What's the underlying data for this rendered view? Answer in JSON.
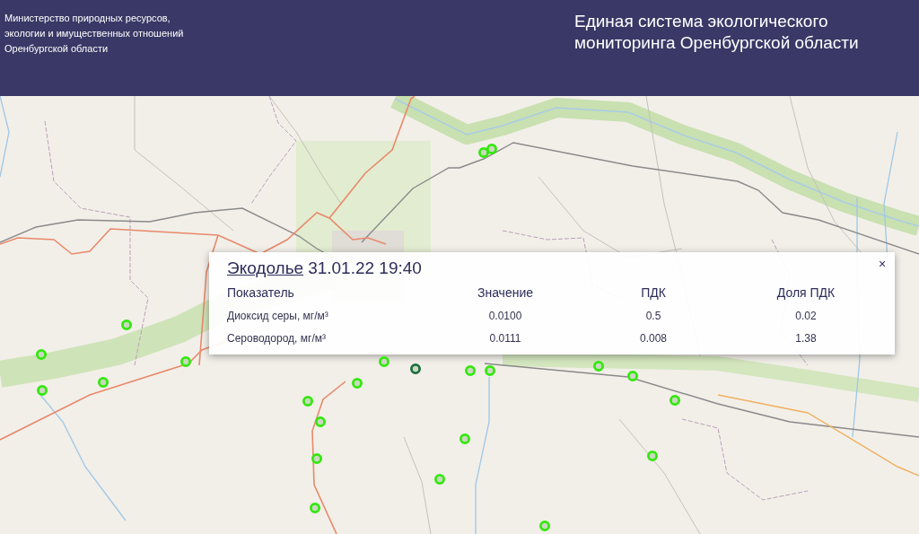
{
  "header": {
    "ministry": "Министерство природных ресурсов,\nэкологии и имущественных отношений\nОренбургской области",
    "title": "Единая система экологического\nмониторинга Оренбургской области"
  },
  "map": {
    "markers": [
      {
        "color": "#33e80c"
      },
      {
        "color": "#33e80c"
      },
      {
        "color": "#33e80c"
      },
      {
        "color": "#33e80c"
      },
      {
        "color": "#33e80c"
      },
      {
        "color": "#33e80c"
      },
      {
        "color": "#33e80c"
      },
      {
        "color": "#1f6e3f"
      },
      {
        "color": "#33e80c"
      },
      {
        "color": "#33e80c"
      },
      {
        "color": "#33e80c"
      },
      {
        "color": "#33e80c"
      },
      {
        "color": "#33e80c"
      },
      {
        "color": "#33e80c"
      },
      {
        "color": "#33e80c"
      },
      {
        "color": "#33e80c"
      },
      {
        "color": "#33e80c"
      },
      {
        "color": "#33e80c"
      },
      {
        "color": "#33e80c"
      },
      {
        "color": "#33e80c"
      },
      {
        "color": "#33e80c"
      },
      {
        "color": "#33e80c"
      },
      {
        "color": "#33e80c"
      }
    ]
  },
  "popup": {
    "station": "Экодолье",
    "datetime": "31.01.22 19:40",
    "close": "×",
    "table": {
      "columns": [
        "Показатель",
        "Значение",
        "ПДК",
        "Доля ПДК"
      ],
      "rows": [
        [
          "Диоксид серы, мг/м³",
          "0.0100",
          "0.5",
          "0.02"
        ],
        [
          "Сероводород, мг/м³",
          "0.0111",
          "0.008",
          "1.38"
        ]
      ]
    }
  }
}
